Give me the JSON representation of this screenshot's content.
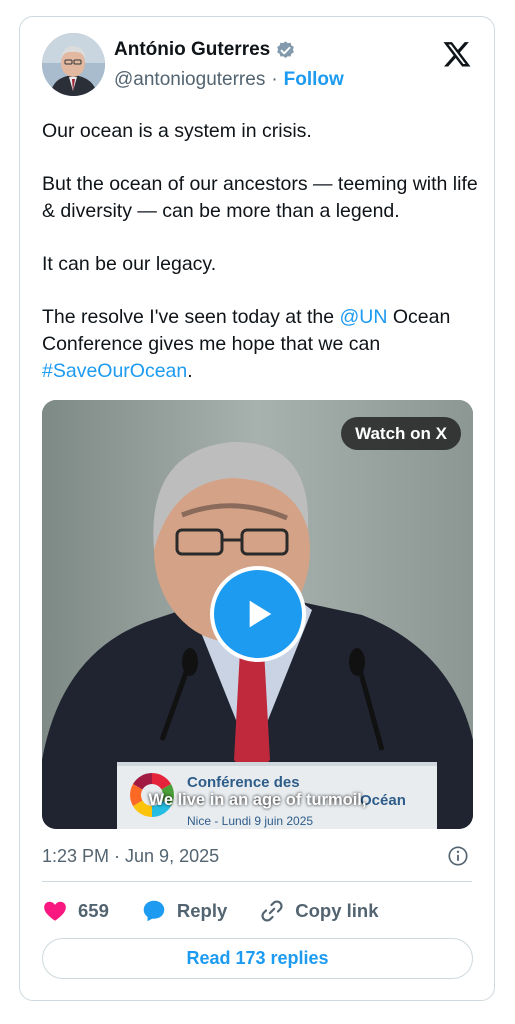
{
  "author": {
    "name": "António Guterres",
    "handle": "@antonioguterres",
    "separator": "·",
    "follow_label": "Follow"
  },
  "tweet": {
    "p1": "Our ocean is a system in crisis.",
    "p2": "But the ocean of our ancestors — teeming with life & diversity — can be more than a legend.",
    "p3": "It can be our legacy.",
    "p4_before": "The resolve I've seen today at the ",
    "p4_mention": "@UN",
    "p4_after": " Ocean Conference gives me hope that we can ",
    "p4_hashtag": "#SaveOurOcean",
    "p4_end": "."
  },
  "media": {
    "watch_label": "Watch on X",
    "subtitle": "We live in an age of turmoil,",
    "podium_line1": "Conférence des",
    "podium_line1b": "Océan",
    "podium_line2": "Nice - Lundi 9 juin 2025"
  },
  "meta": {
    "timestamp": "1:23 PM · Jun 9, 2025"
  },
  "actions": {
    "like_count": "659",
    "reply_label": "Reply",
    "copy_label": "Copy link"
  },
  "footer": {
    "read_replies_label": "Read 173 replies"
  },
  "colors": {
    "accent": "#1d9bf0",
    "like": "#f91880",
    "text": "#0f1419",
    "muted": "#536471",
    "border": "#cfd9de"
  }
}
